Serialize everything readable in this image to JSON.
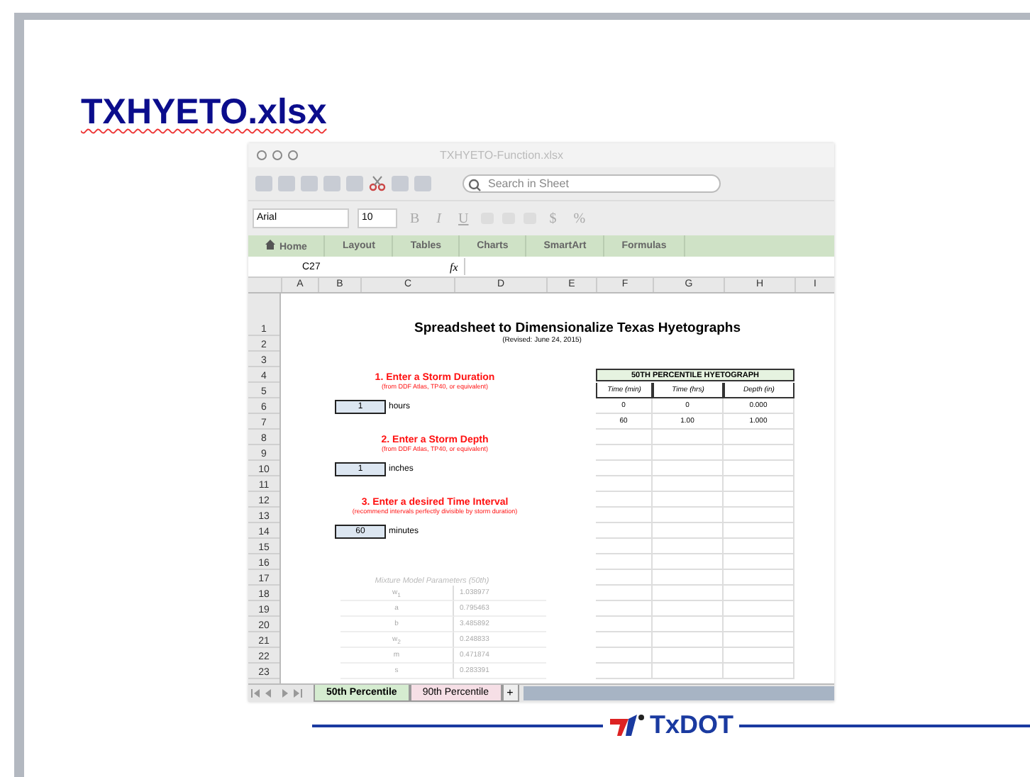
{
  "slide": {
    "title": "TXHYETO.xlsx"
  },
  "excel": {
    "title": "TXHYETO-Function.xlsx",
    "search": {
      "placeholder": "Search in Sheet"
    },
    "font": "Arial",
    "font_size": "10",
    "format_buttons": [
      "B",
      "I",
      "U"
    ],
    "number_buttons": [
      "$",
      "%"
    ],
    "ribbon_tabs": [
      "Home",
      "Layout",
      "Tables",
      "Charts",
      "SmartArt",
      "Formulas"
    ],
    "cell_ref": "C27",
    "function_label": "fx",
    "columns": [
      "A",
      "B",
      "C",
      "D",
      "E",
      "F",
      "G",
      "H",
      "I"
    ],
    "rows": [
      "1",
      "2",
      "3",
      "4",
      "5",
      "6",
      "7",
      "8",
      "9",
      "10",
      "11",
      "12",
      "13",
      "14",
      "15",
      "16",
      "17",
      "18",
      "19",
      "20",
      "21",
      "22",
      "23"
    ],
    "sheet": {
      "heading": "Spreadsheet to Dimensionalize Texas Hyetographs",
      "revised": "(Revised: June 24, 2015)",
      "inputs": [
        {
          "title": "1.  Enter a Storm Duration",
          "note": "(from DDF Atlas, TP40, or equivalent)",
          "value": "1",
          "unit": "hours"
        },
        {
          "title": "2.  Enter a Storm Depth",
          "note": "(from DDF Atlas, TP40, or equivalent)",
          "value": "1",
          "unit": "inches"
        },
        {
          "title": "3. Enter a desired Time Interval",
          "note": "(recommend intervals perfectly divisible by storm duration)",
          "value": "60",
          "unit": "minutes"
        }
      ],
      "hyetograph": {
        "title": "50TH PERCENTILE HYETOGRAPH",
        "columns": [
          "Time (min)",
          "Time (hrs)",
          "Depth (in)"
        ],
        "rows": [
          [
            "0",
            "0",
            "0.000"
          ],
          [
            "60",
            "1.00",
            "1.000"
          ]
        ]
      },
      "mixture": {
        "title": "Mixture Model Parameters (50th)",
        "rows": [
          {
            "name": "w$_{1}$",
            "value": "1.038977"
          },
          {
            "name": "a",
            "value": "0.795463"
          },
          {
            "name": "b",
            "value": "3.485892"
          },
          {
            "name": "w$_{2}$",
            "value": "0.248833"
          },
          {
            "name": "m",
            "value": "0.471874"
          },
          {
            "name": "s",
            "value": "0.283391"
          }
        ]
      }
    },
    "add_sheet": "+",
    "sheet_tabs": [
      {
        "label": "50th Percentile",
        "selected": true
      },
      {
        "label": "90th Percentile",
        "selected": false
      }
    ]
  },
  "footer": {
    "logo": "TxDOT"
  }
}
